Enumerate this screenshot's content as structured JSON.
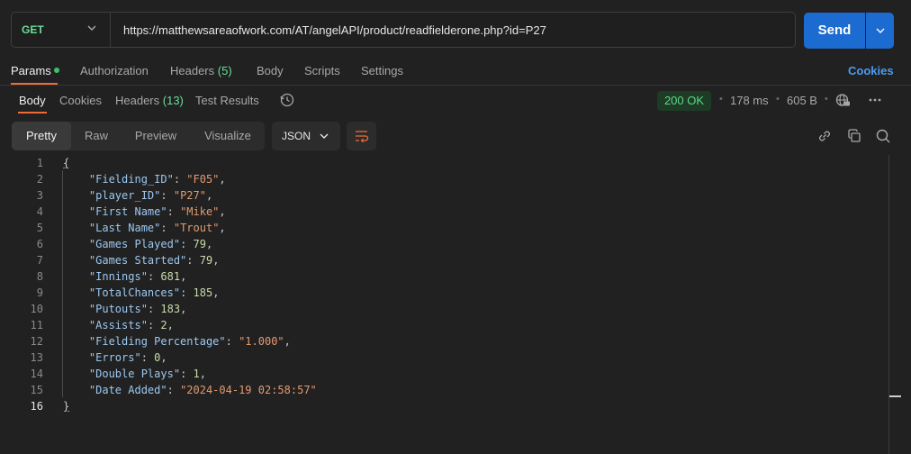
{
  "request": {
    "method": "GET",
    "url": "https://matthewsareaofwork.com/AT/angelAPI/product/readfielderone.php?id=P27",
    "send_label": "Send"
  },
  "request_tabs": {
    "params": "Params",
    "authorization": "Authorization",
    "headers": "Headers",
    "headers_count": "(5)",
    "body": "Body",
    "scripts": "Scripts",
    "settings": "Settings",
    "cookies_link": "Cookies"
  },
  "response_tabs": {
    "body": "Body",
    "cookies": "Cookies",
    "headers": "Headers",
    "headers_count": "(13)",
    "test_results": "Test Results"
  },
  "response_meta": {
    "status": "200 OK",
    "time": "178 ms",
    "size": "605 B"
  },
  "view_modes": {
    "pretty": "Pretty",
    "raw": "Raw",
    "preview": "Preview",
    "visualize": "Visualize",
    "format": "JSON"
  },
  "icons": {
    "history": "history-icon",
    "globe": "globe-icon",
    "more": "more-icon",
    "link": "link-icon",
    "copy": "copy-icon",
    "search": "search-icon",
    "wrap": "wrap-lines-icon"
  },
  "colors": {
    "accent": "#ef6b35",
    "send": "#1c6bd1",
    "status_ok": "#5ed68a"
  },
  "response_body": {
    "open": "{",
    "close": "}",
    "fields": [
      {
        "key": "\"Fielding_ID\"",
        "value": "\"F05\"",
        "type": "str"
      },
      {
        "key": "\"player_ID\"",
        "value": "\"P27\"",
        "type": "str"
      },
      {
        "key": "\"First Name\"",
        "value": "\"Mike\"",
        "type": "str"
      },
      {
        "key": "\"Last Name\"",
        "value": "\"Trout\"",
        "type": "str"
      },
      {
        "key": "\"Games Played\"",
        "value": "79",
        "type": "num"
      },
      {
        "key": "\"Games Started\"",
        "value": "79",
        "type": "num"
      },
      {
        "key": "\"Innings\"",
        "value": "681",
        "type": "num"
      },
      {
        "key": "\"TotalChances\"",
        "value": "185",
        "type": "num"
      },
      {
        "key": "\"Putouts\"",
        "value": "183",
        "type": "num"
      },
      {
        "key": "\"Assists\"",
        "value": "2",
        "type": "num"
      },
      {
        "key": "\"Fielding Percentage\"",
        "value": "\"1.000\"",
        "type": "str"
      },
      {
        "key": "\"Errors\"",
        "value": "0",
        "type": "num"
      },
      {
        "key": "\"Double Plays\"",
        "value": "1",
        "type": "num"
      },
      {
        "key": "\"Date Added\"",
        "value": "\"2024-04-19 02:58:57\"",
        "type": "str"
      }
    ]
  }
}
